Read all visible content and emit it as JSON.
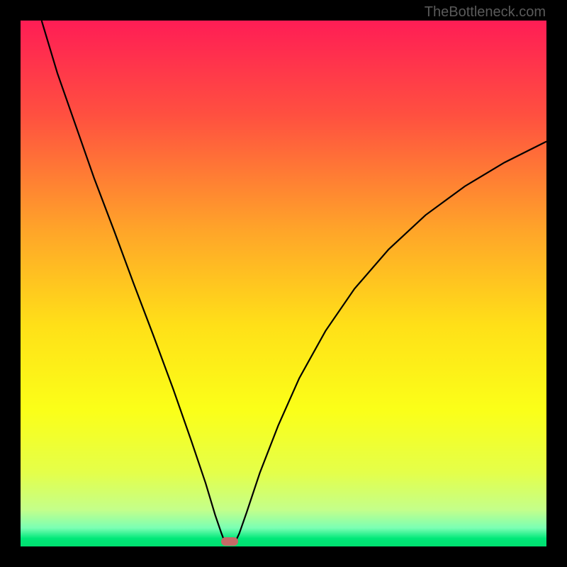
{
  "watermark": "TheBottleneck.com",
  "chart_data": {
    "type": "line",
    "title": "",
    "xlabel": "",
    "ylabel": "",
    "xlim": [
      0,
      100
    ],
    "ylim": [
      0,
      100
    ],
    "background_gradient": {
      "stops": [
        {
          "pos": 0.0,
          "color": "#ff1d55"
        },
        {
          "pos": 0.18,
          "color": "#ff5040"
        },
        {
          "pos": 0.4,
          "color": "#ffa529"
        },
        {
          "pos": 0.58,
          "color": "#ffe018"
        },
        {
          "pos": 0.74,
          "color": "#fbff18"
        },
        {
          "pos": 0.86,
          "color": "#e4ff4a"
        },
        {
          "pos": 0.93,
          "color": "#c4ff8a"
        },
        {
          "pos": 0.965,
          "color": "#7affb4"
        },
        {
          "pos": 0.985,
          "color": "#00e878"
        },
        {
          "pos": 1.0,
          "color": "#00e070"
        }
      ]
    },
    "series": [
      {
        "name": "bottleneck-curve",
        "color": "#000000",
        "points": [
          {
            "x": 4.0,
            "y": 100.0
          },
          {
            "x": 7.0,
            "y": 90.0
          },
          {
            "x": 10.5,
            "y": 80.0
          },
          {
            "x": 14.0,
            "y": 70.0
          },
          {
            "x": 17.8,
            "y": 60.0
          },
          {
            "x": 21.5,
            "y": 50.0
          },
          {
            "x": 25.3,
            "y": 40.0
          },
          {
            "x": 29.0,
            "y": 30.0
          },
          {
            "x": 32.5,
            "y": 20.0
          },
          {
            "x": 35.2,
            "y": 12.0
          },
          {
            "x": 37.0,
            "y": 6.0
          },
          {
            "x": 38.2,
            "y": 2.5
          },
          {
            "x": 38.7,
            "y": 1.2
          },
          {
            "x": 39.0,
            "y": 0.8
          },
          {
            "x": 40.5,
            "y": 0.8
          },
          {
            "x": 41.0,
            "y": 1.2
          },
          {
            "x": 41.6,
            "y": 2.5
          },
          {
            "x": 43.0,
            "y": 6.5
          },
          {
            "x": 45.5,
            "y": 14.0
          },
          {
            "x": 49.0,
            "y": 23.0
          },
          {
            "x": 53.0,
            "y": 32.0
          },
          {
            "x": 58.0,
            "y": 41.0
          },
          {
            "x": 63.5,
            "y": 49.0
          },
          {
            "x": 70.0,
            "y": 56.5
          },
          {
            "x": 77.0,
            "y": 63.0
          },
          {
            "x": 84.5,
            "y": 68.5
          },
          {
            "x": 92.0,
            "y": 73.0
          },
          {
            "x": 100.0,
            "y": 77.0
          }
        ]
      }
    ],
    "marker": {
      "x": 39.8,
      "y": 1.0,
      "color": "#c56a67"
    }
  }
}
